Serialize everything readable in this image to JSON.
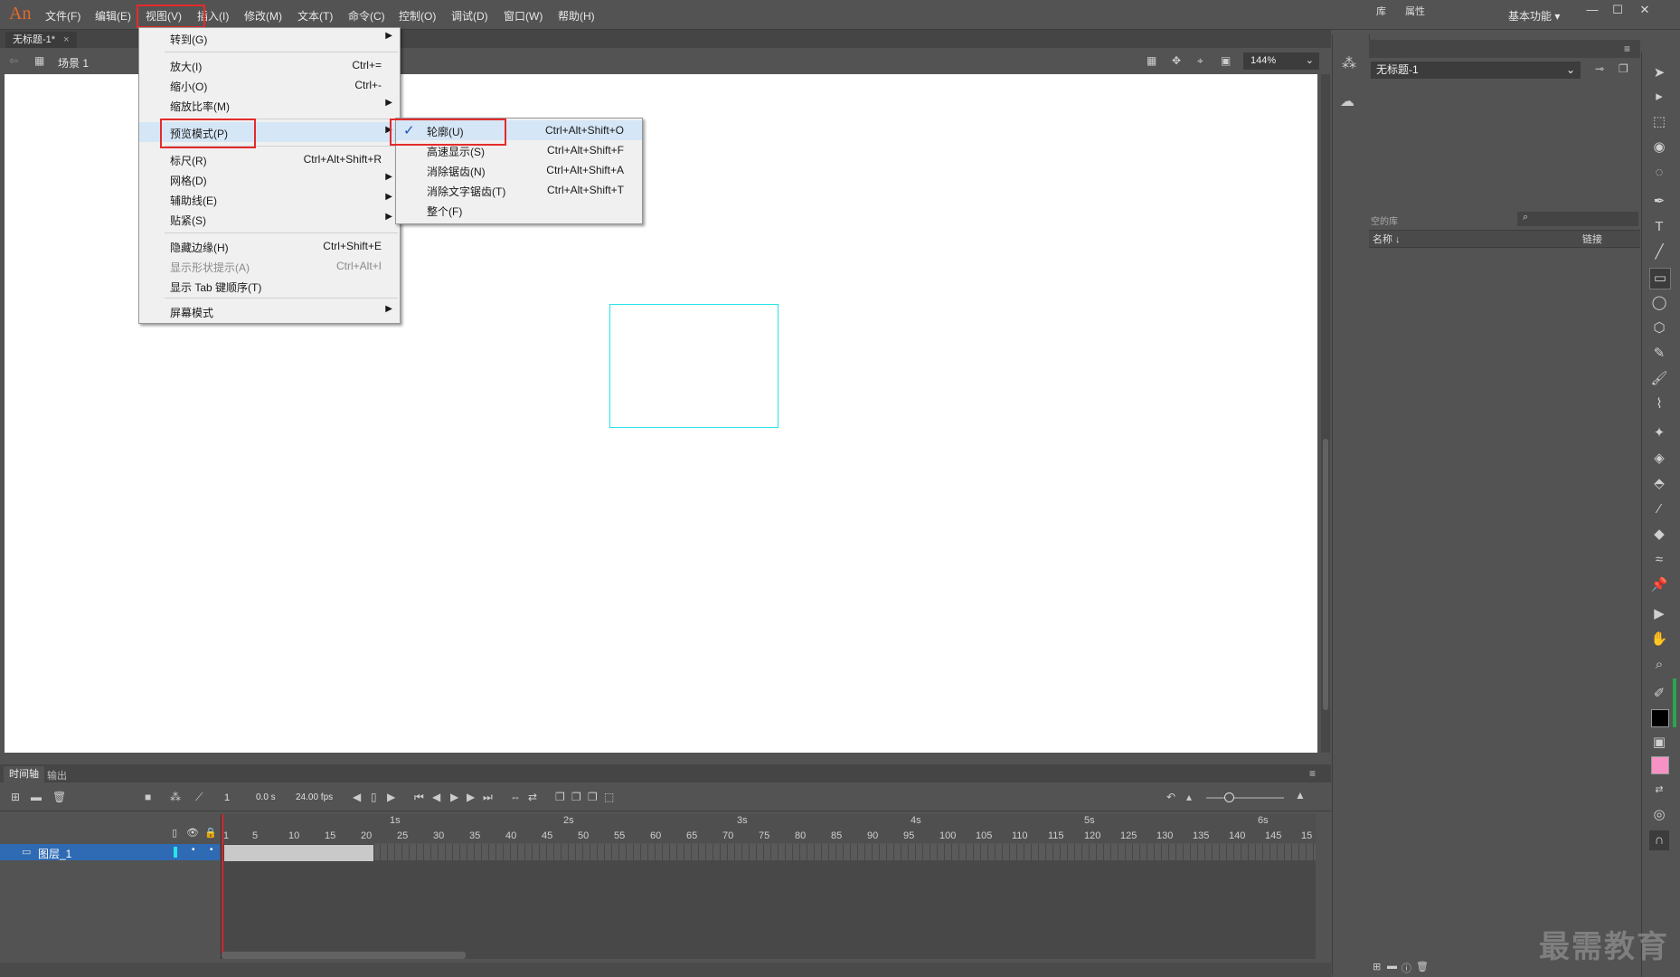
{
  "app": {
    "logo": "An"
  },
  "menubar": {
    "items": [
      "文件(F)",
      "编辑(E)",
      "视图(V)",
      "插入(I)",
      "修改(M)",
      "文本(T)",
      "命令(C)",
      "控制(O)",
      "调试(D)",
      "窗口(W)",
      "帮助(H)"
    ],
    "workspace": "基本功能"
  },
  "document": {
    "tab": "无标题-1*",
    "scene": "场景 1",
    "zoom": "144%"
  },
  "view_menu": {
    "items": [
      {
        "label": "转到(G)",
        "shortcut": "",
        "submenu": true
      },
      {
        "label": "放大(I)",
        "shortcut": "Ctrl+=",
        "submenu": false
      },
      {
        "label": "缩小(O)",
        "shortcut": "Ctrl+-",
        "submenu": false
      },
      {
        "label": "缩放比率(M)",
        "shortcut": "",
        "submenu": true
      },
      {
        "label": "预览模式(P)",
        "shortcut": "",
        "submenu": true
      },
      {
        "label": "标尺(R)",
        "shortcut": "Ctrl+Alt+Shift+R",
        "submenu": false
      },
      {
        "label": "网格(D)",
        "shortcut": "",
        "submenu": true
      },
      {
        "label": "辅助线(E)",
        "shortcut": "",
        "submenu": true
      },
      {
        "label": "贴紧(S)",
        "shortcut": "",
        "submenu": true
      },
      {
        "label": "隐藏边缘(H)",
        "shortcut": "Ctrl+Shift+E",
        "submenu": false
      },
      {
        "label": "显示形状提示(A)",
        "shortcut": "Ctrl+Alt+I",
        "submenu": false,
        "disabled": true
      },
      {
        "label": "显示 Tab 键顺序(T)",
        "shortcut": "",
        "submenu": false
      },
      {
        "label": "屏幕模式",
        "shortcut": "",
        "submenu": true
      }
    ]
  },
  "preview_submenu": {
    "items": [
      {
        "label": "轮廓(U)",
        "shortcut": "Ctrl+Alt+Shift+O",
        "checked": true
      },
      {
        "label": "高速显示(S)",
        "shortcut": "Ctrl+Alt+Shift+F"
      },
      {
        "label": "消除锯齿(N)",
        "shortcut": "Ctrl+Alt+Shift+A"
      },
      {
        "label": "消除文字锯齿(T)",
        "shortcut": "Ctrl+Alt+Shift+T"
      },
      {
        "label": "整个(F)",
        "shortcut": ""
      }
    ],
    "check_mark": "✓"
  },
  "library": {
    "tabs": [
      "库",
      "属性"
    ],
    "selected_doc": "无标题-1",
    "count": "空的库",
    "col_name": "名称 ↓",
    "col_link": "链接"
  },
  "timeline": {
    "tabs": [
      "时间轴",
      "输出"
    ],
    "frame": "1",
    "time": "0.0 s",
    "fps": "24.00 fps",
    "layer_name": "图层_1",
    "frame_numbers": [
      "1",
      "5",
      "10",
      "15",
      "20",
      "25",
      "30",
      "35",
      "40",
      "45",
      "50",
      "55",
      "60",
      "65",
      "70",
      "75",
      "80",
      "85",
      "90",
      "95",
      "100",
      "105",
      "110",
      "115",
      "120",
      "125",
      "130",
      "135",
      "140",
      "145",
      "15"
    ],
    "seconds": [
      "1s",
      "2s",
      "3s",
      "4s",
      "5s",
      "6s"
    ]
  },
  "watermark": "最需教育",
  "colors": {
    "outline_rect": "#27e4e8",
    "highlight_box": "#e52b2b",
    "layer_selected": "#2f6bb4",
    "playhead": "#d3282f",
    "fill_swatch": "#f792c4",
    "stroke_swatch": "#000000"
  }
}
